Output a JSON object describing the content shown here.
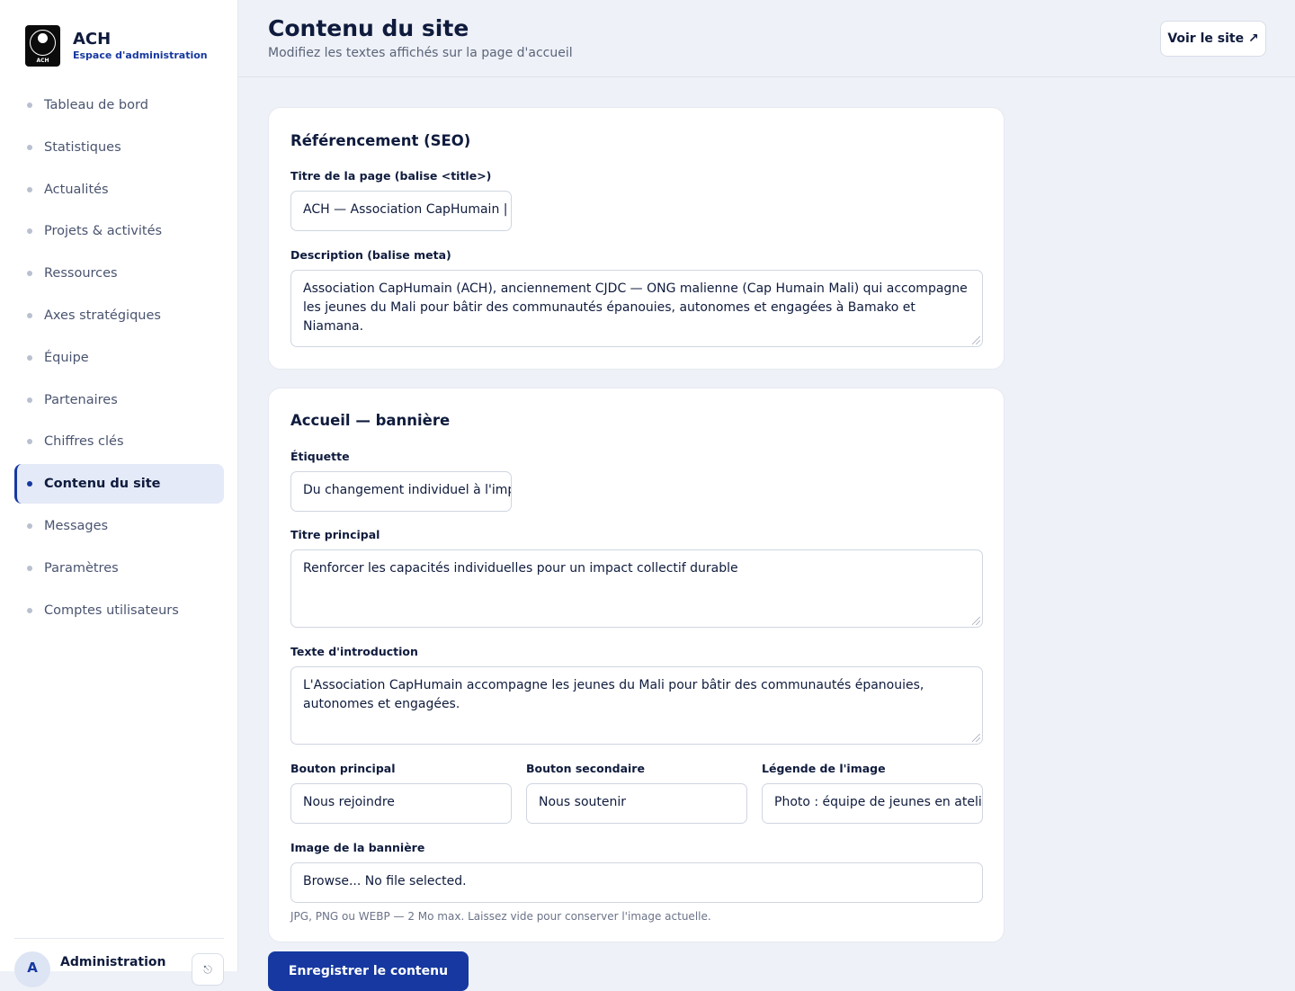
{
  "brand": {
    "title": "ACH",
    "subtitle": "Espace d'administration",
    "logo_label": "ACH",
    "logo_icon": "community-logo-icon"
  },
  "sidebar": {
    "items": [
      {
        "label": "Tableau de bord"
      },
      {
        "label": "Statistiques"
      },
      {
        "label": "Actualités"
      },
      {
        "label": "Projets & activités"
      },
      {
        "label": "Ressources"
      },
      {
        "label": "Axes stratégiques"
      },
      {
        "label": "Équipe"
      },
      {
        "label": "Partenaires"
      },
      {
        "label": "Chiffres clés"
      },
      {
        "label": "Contenu du site",
        "active": true
      },
      {
        "label": "Messages"
      },
      {
        "label": "Paramètres"
      },
      {
        "label": "Comptes utilisateurs"
      }
    ],
    "user": {
      "initial": "A",
      "name": "Administration",
      "logout_icon": "logout-icon"
    }
  },
  "header": {
    "title": "Contenu du site",
    "subtitle": "Modifiez les textes affichés sur la page d'accueil",
    "view_site_label": "Voir le site ↗"
  },
  "seo": {
    "heading": "Référencement (SEO)",
    "title_label": "Titre de la page (balise <title>)",
    "title_value": "ACH — Association CapHumain |",
    "description_label": "Description (balise meta)",
    "description_value": "Association CapHumain (ACH), anciennement CJDC — ONG malienne (Cap Humain Mali) qui accompagne les jeunes du Mali pour bâtir des communautés épanouies, autonomes et engagées à Bamako et Niamana."
  },
  "hero": {
    "heading": "Accueil — bannière",
    "tag_label": "Étiquette",
    "tag_value": "Du changement individuel à l'imp",
    "main_title_label": "Titre principal",
    "main_title_value": "Renforcer les capacités individuelles pour un impact collectif durable",
    "intro_label": "Texte d'introduction",
    "intro_value": "L'Association CapHumain accompagne les jeunes du Mali pour bâtir des communautés épanouies, autonomes et engagées.",
    "primary_btn_label": "Bouton principal",
    "primary_btn_value": "Nous rejoindre",
    "secondary_btn_label": "Bouton secondaire",
    "secondary_btn_value": "Nous soutenir",
    "caption_label": "Légende de l'image",
    "caption_value": "Photo : équipe de jeunes en atelie",
    "image_label": "Image de la bannière",
    "image_value": "Browse... No file selected.",
    "image_help": "JPG, PNG ou WEBP — 2 Mo max. Laissez vide pour conserver l'image actuelle."
  },
  "save_label": "Enregistrer le contenu"
}
